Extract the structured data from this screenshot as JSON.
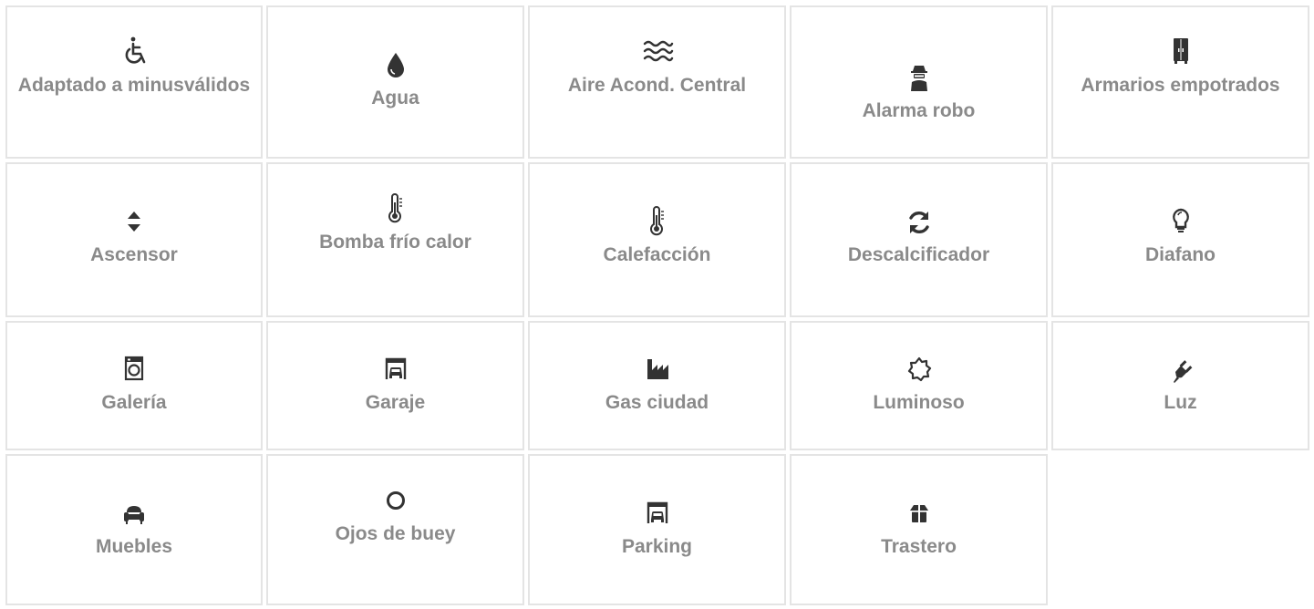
{
  "features": [
    {
      "label": "Adaptado a minusválidos",
      "icon": "wheelchair-icon"
    },
    {
      "label": "Agua",
      "icon": "water-drop-icon"
    },
    {
      "label": "Aire Acond. Central",
      "icon": "air-waves-icon"
    },
    {
      "label": "Alarma robo",
      "icon": "burglar-alarm-icon"
    },
    {
      "label": "Armarios empotrados",
      "icon": "wardrobe-icon"
    },
    {
      "label": "Ascensor",
      "icon": "elevator-arrows-icon"
    },
    {
      "label": "Bomba frío calor",
      "icon": "thermometer-icon"
    },
    {
      "label": "Calefacción",
      "icon": "thermometer-icon"
    },
    {
      "label": "Descalcificador",
      "icon": "refresh-icon"
    },
    {
      "label": "Diafano",
      "icon": "light-bulb-icon"
    },
    {
      "label": "Galería",
      "icon": "washing-machine-icon"
    },
    {
      "label": "Garaje",
      "icon": "garage-icon"
    },
    {
      "label": "Gas ciudad",
      "icon": "factory-icon"
    },
    {
      "label": "Luminoso",
      "icon": "sun-icon"
    },
    {
      "label": "Luz",
      "icon": "plug-icon"
    },
    {
      "label": "Muebles",
      "icon": "armchair-icon"
    },
    {
      "label": "Ojos de buey",
      "icon": "circle-icon"
    },
    {
      "label": "Parking",
      "icon": "garage-icon"
    },
    {
      "label": "Trastero",
      "icon": "storage-box-icon"
    }
  ],
  "colors": {
    "text": "#8a8a8a",
    "icon": "#333333",
    "border": "#e4e4e4"
  }
}
